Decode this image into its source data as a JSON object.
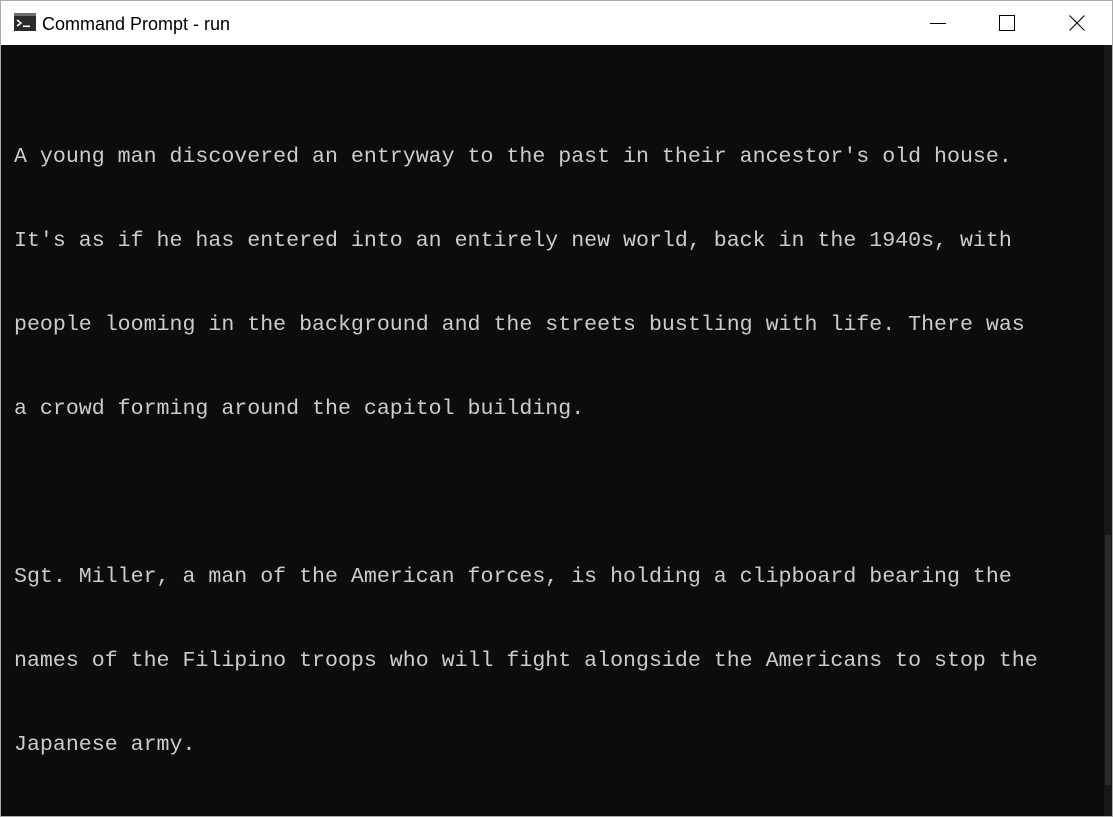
{
  "window": {
    "title": "Command Prompt - run",
    "icon": "command-prompt-icon",
    "controls": {
      "minimize_icon": "minimize-icon",
      "maximize_icon": "maximize-icon",
      "close_icon": "close-icon"
    }
  },
  "terminal": {
    "background": "#0c0c0c",
    "foreground": "#cccccc",
    "paragraphs": [
      {
        "lines": [
          "A young man discovered an entryway to the past in their ancestor's old house.",
          "It's as if he has entered into an entirely new world, back in the 1940s, with",
          "people looming in the background and the streets bustling with life. There was",
          "a crowd forming around the capitol building."
        ]
      },
      {
        "lines": [
          "Sgt. Miller, a man of the American forces, is holding a clipboard bearing the",
          "names of the Filipino troops who will fight alongside the Americans to stop the",
          "Japanese army."
        ]
      }
    ],
    "prompt": ">",
    "input_value": ""
  }
}
